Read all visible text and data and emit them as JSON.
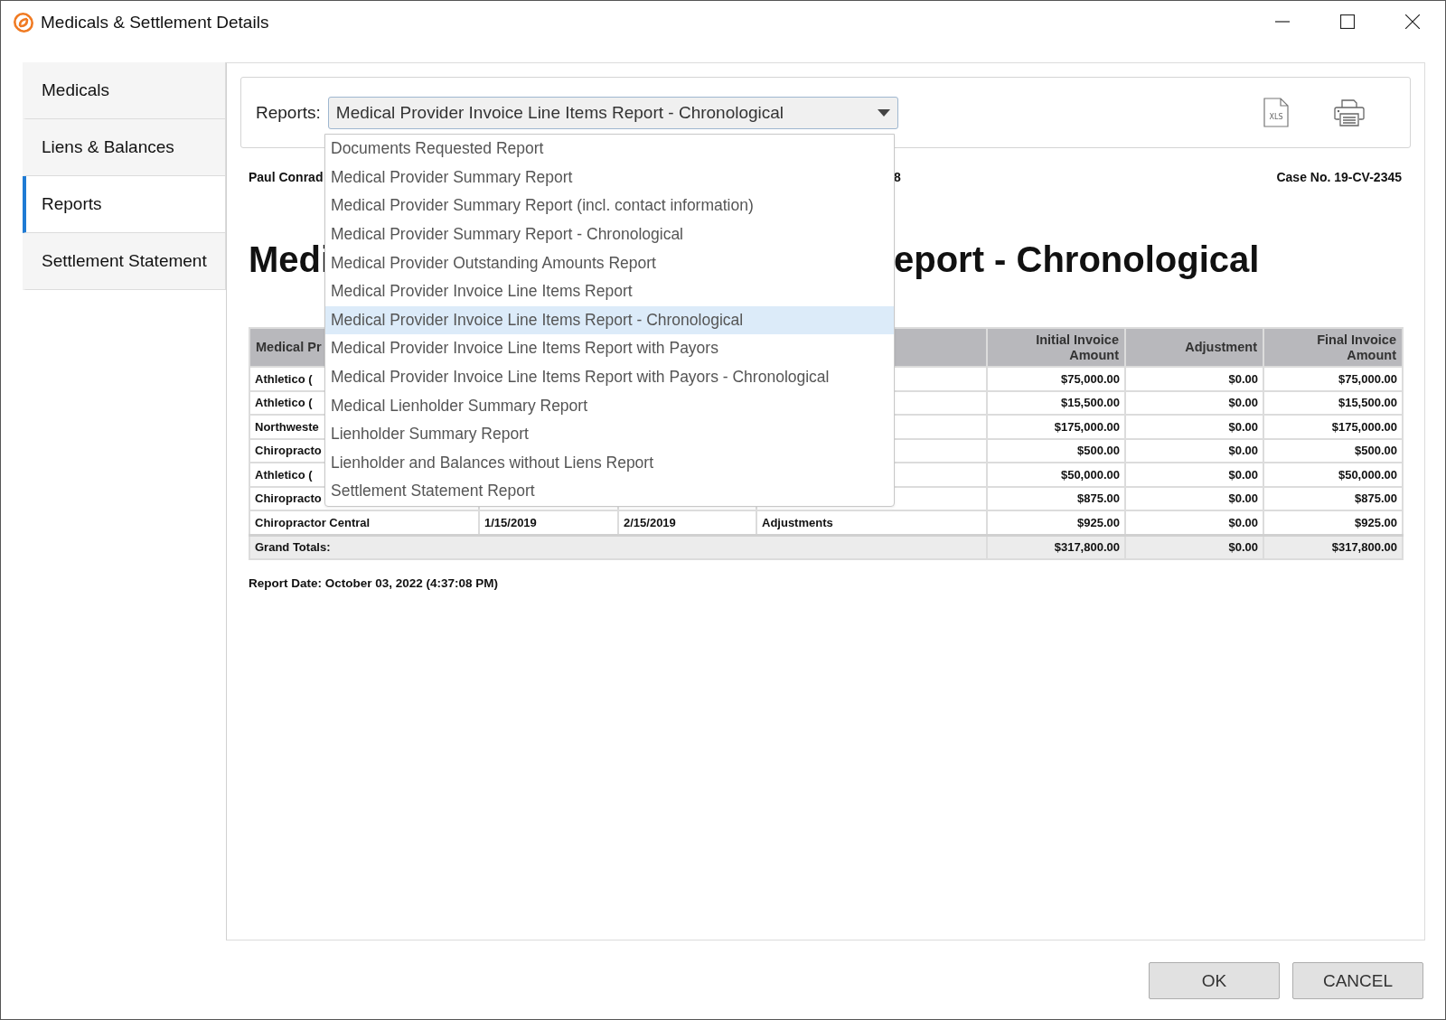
{
  "window": {
    "title": "Medicals & Settlement Details"
  },
  "sidebar": {
    "items": [
      {
        "label": "Medicals",
        "selected": false
      },
      {
        "label": "Liens & Balances",
        "selected": false
      },
      {
        "label": "Reports",
        "selected": true
      },
      {
        "label": "Settlement Statement",
        "selected": false
      }
    ]
  },
  "toolbar": {
    "label": "Reports:",
    "select_value": "Medical Provider Invoice Line Items Report - Chronological",
    "expanded": true,
    "export_icon_label": "XLS"
  },
  "dropdown": {
    "options": [
      {
        "label": "Documents Requested Report",
        "selected": false
      },
      {
        "label": "Medical Provider Summary Report",
        "selected": false
      },
      {
        "label": "Medical Provider Summary Report (incl. contact information)",
        "selected": false
      },
      {
        "label": "Medical Provider Summary Report - Chronological",
        "selected": false
      },
      {
        "label": "Medical Provider Outstanding Amounts Report",
        "selected": false
      },
      {
        "label": "Medical Provider Invoice Line Items Report",
        "selected": false
      },
      {
        "label": "Medical Provider Invoice Line Items Report - Chronological",
        "selected": true
      },
      {
        "label": "Medical Provider Invoice Line Items Report with Payors",
        "selected": false
      },
      {
        "label": "Medical Provider Invoice Line Items Report with Payors - Chronological",
        "selected": false
      },
      {
        "label": "Medical Lienholder Summary Report",
        "selected": false
      },
      {
        "label": "Lienholder Summary Report",
        "selected": false
      },
      {
        "label": "Lienholder and Balances without Liens Report",
        "selected": false
      },
      {
        "label": "Settlement Statement Report",
        "selected": false
      }
    ]
  },
  "report": {
    "client_name": "Paul Conrad",
    "header_fragment": "8",
    "case_number": "Case No. 19-CV-2345",
    "title_start": "Medi",
    "title_end": "eport - Chronological",
    "table": {
      "columns": {
        "column_1": "Medical Pr",
        "column_5": "Initial Invoice Amount",
        "column_6": "Adjustment",
        "column_7": "Final Invoice Amount"
      },
      "rows": [
        {
          "column_1": "Athletico (",
          "column_5": "$75,000.00",
          "column_6": "$0.00",
          "column_7": "$75,000.00"
        },
        {
          "column_1": "Athletico (",
          "column_5": "$15,500.00",
          "column_6": "$0.00",
          "column_7": "$15,500.00"
        },
        {
          "column_1": "Northweste",
          "column_5": "$175,000.00",
          "column_6": "$0.00",
          "column_7": "$175,000.00"
        },
        {
          "column_1": "Chiropracto",
          "column_5": "$500.00",
          "column_6": "$0.00",
          "column_7": "$500.00"
        },
        {
          "column_1": "Athletico (",
          "column_5": "$50,000.00",
          "column_6": "$0.00",
          "column_7": "$50,000.00"
        },
        {
          "column_1": "Chiropracto",
          "column_5": "$875.00",
          "column_6": "$0.00",
          "column_7": "$875.00"
        },
        {
          "column_1": "Chiropractor Central",
          "column_2": "1/15/2019",
          "column_3": "2/15/2019",
          "column_4": "Adjustments",
          "column_5": "$925.00",
          "column_6": "$0.00",
          "column_7": "$925.00"
        }
      ],
      "totals": {
        "label": "Grand Totals:",
        "column_5": "$317,800.00",
        "column_6": "$0.00",
        "column_7": "$317,800.00"
      }
    },
    "report_date": "Report Date: October 03, 2022 (4:37:08 PM)"
  },
  "buttons": [
    "OK",
    "CANCEL"
  ]
}
